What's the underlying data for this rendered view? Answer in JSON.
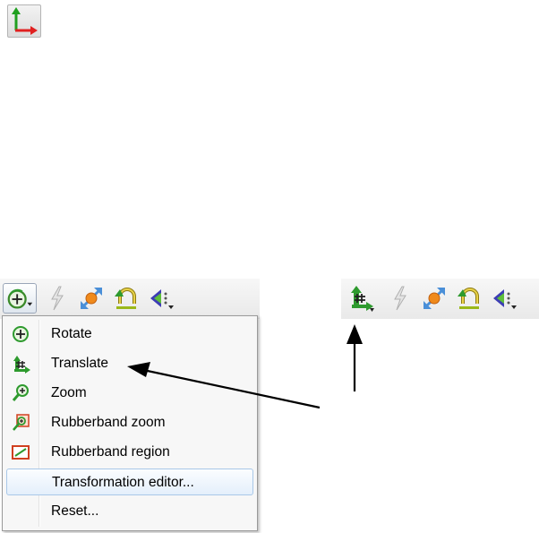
{
  "toolbar_left": {
    "view_button_icon": "rotate-plus-icon",
    "icons": [
      "lightning-icon",
      "scale-arrows-icon",
      "undo-arc-icon",
      "eye-dropdown-icon"
    ]
  },
  "toolbar_right": {
    "translate_icon": "translate-icon",
    "icons": [
      "lightning-icon",
      "scale-arrows-icon",
      "undo-arc-icon",
      "eye-dropdown-icon"
    ]
  },
  "menu": {
    "items": [
      {
        "label": "Rotate",
        "icon": "rotate-icon"
      },
      {
        "label": "Translate",
        "icon": "translate-icon"
      },
      {
        "label": "Zoom",
        "icon": "zoom-icon"
      },
      {
        "label": "Rubberband zoom",
        "icon": "rubberband-zoom-icon"
      },
      {
        "label": "Rubberband region",
        "icon": "rubberband-region-icon"
      },
      {
        "label": "Transformation editor...",
        "icon": ""
      },
      {
        "label": "Reset...",
        "icon": ""
      }
    ],
    "highlighted_index": 5
  },
  "colors": {
    "accent_green": "#2e9a2e",
    "accent_red": "#e02020",
    "highlight_border": "#a9c8e8"
  }
}
